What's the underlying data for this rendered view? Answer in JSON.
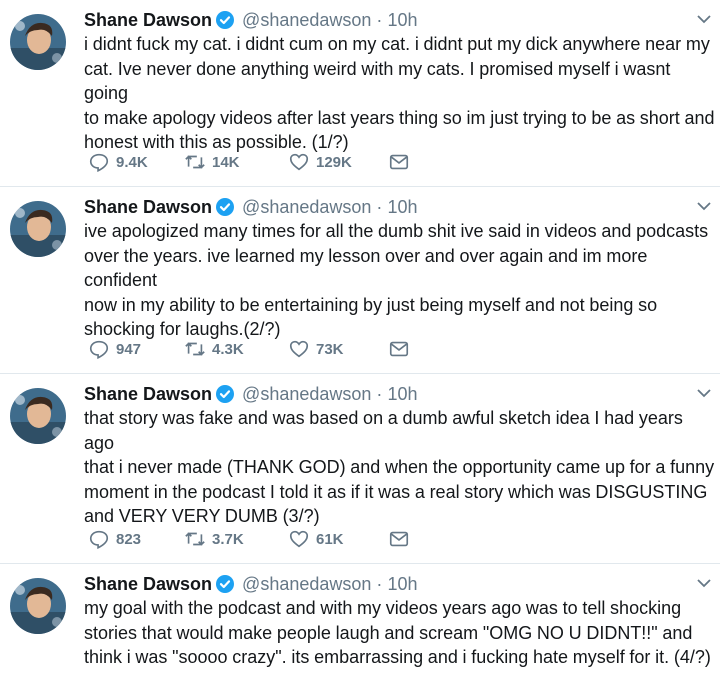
{
  "tweets": [
    {
      "name": "Shane Dawson",
      "handle": "@shanedawson",
      "sep": "·",
      "time": "10h",
      "lines": [
        "i didnt fuck my cat. i didnt cum on my cat. i didnt put my dick anywhere near my",
        "cat. Ive never done anything weird with my cats. I promised myself i wasnt going",
        "to make apology videos after last years thing so im just trying to be as short and",
        "honest with this as possible. (1/?)"
      ],
      "replies": "9.4K",
      "retweets": "14K",
      "likes": "129K"
    },
    {
      "name": "Shane Dawson",
      "handle": "@shanedawson",
      "sep": "·",
      "time": "10h",
      "lines": [
        "ive apologized many times for all the dumb shit ive said in videos and podcasts",
        "over the years. ive learned my lesson over and over again and im more confident",
        "now in my ability to be entertaining by just being myself and not being so",
        "shocking for laughs.(2/?)"
      ],
      "replies": "947",
      "retweets": "4.3K",
      "likes": "73K"
    },
    {
      "name": "Shane Dawson",
      "handle": "@shanedawson",
      "sep": "·",
      "time": "10h",
      "lines": [
        "that story was fake and was based on a dumb awful sketch idea I had years ago",
        "that i never made (THANK GOD) and when the opportunity came up for a funny",
        "moment in the podcast I told it as if it was a real story which was DISGUSTING",
        "and VERY VERY DUMB (3/?)"
      ],
      "replies": "823",
      "retweets": "3.7K",
      "likes": "61K"
    },
    {
      "name": "Shane Dawson",
      "handle": "@shanedawson",
      "sep": "·",
      "time": "10h",
      "lines": [
        "my goal with the podcast and with my videos years ago was to tell shocking",
        "stories that would make people laugh and scream \"OMG NO U DIDNT!!\" and",
        "think i was \"soooo crazy\". its embarrassing and i fucking hate myself for it. (4/?)"
      ]
    }
  ],
  "icons": {
    "verified": "verified-badge-icon",
    "caret": "chevron-down-icon",
    "reply": "reply-icon",
    "retweet": "retweet-icon",
    "like": "heart-icon",
    "dm": "envelope-icon"
  },
  "colors": {
    "verified": "#1da1f2",
    "text": "#14171a",
    "secondary": "#657786",
    "divider": "#e1e8ed"
  }
}
